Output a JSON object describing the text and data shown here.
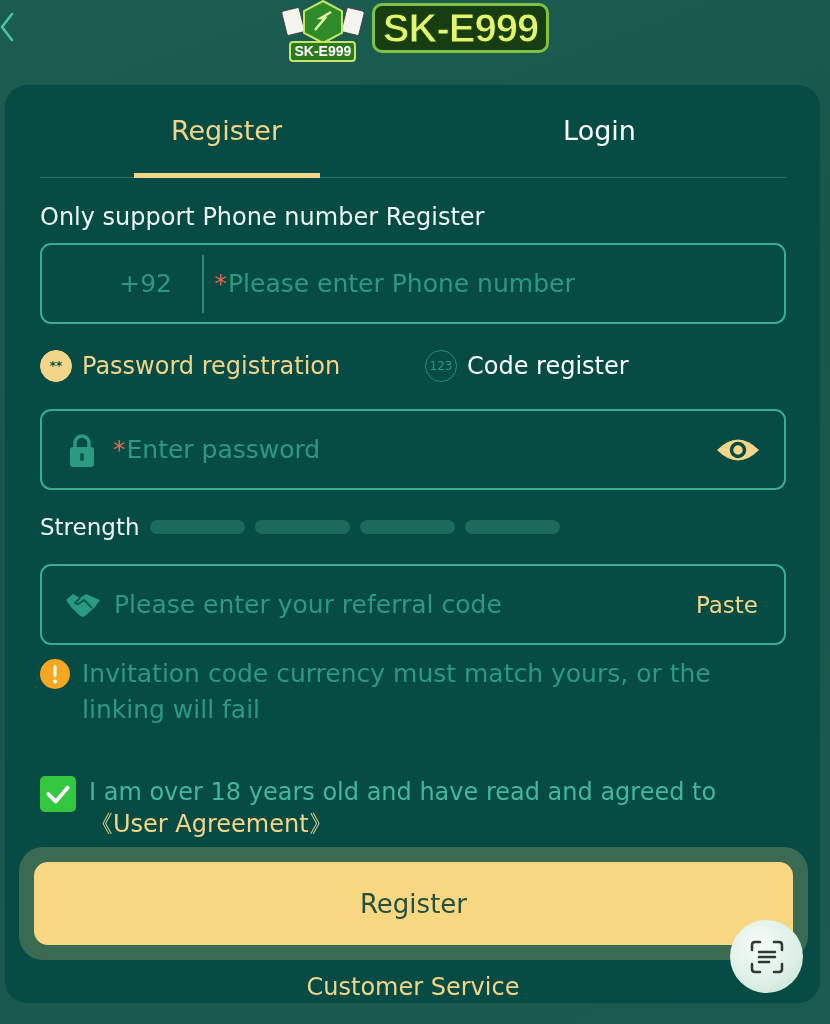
{
  "logo": {
    "emblem_text": "SK-E999",
    "wordmark": "SK-E999"
  },
  "tabs": [
    {
      "label": "Register",
      "selected": true
    },
    {
      "label": "Login",
      "selected": false
    }
  ],
  "phone_section": {
    "label": "Only support Phone number Register",
    "country_code": "+92",
    "required_mark": "*",
    "placeholder": "Please enter Phone number"
  },
  "register_modes": [
    {
      "icon_text": "**",
      "label": "Password registration",
      "selected": true
    },
    {
      "icon_text": "123",
      "label": "Code register",
      "selected": false
    }
  ],
  "password_field": {
    "required_mark": "*",
    "placeholder": "Enter password"
  },
  "strength": {
    "label": "Strength",
    "segments": [
      {
        "lit": false
      },
      {
        "lit": false
      },
      {
        "lit": false
      },
      {
        "lit": false
      }
    ]
  },
  "referral_field": {
    "placeholder": "Please enter your referral code",
    "paste_label": "Paste"
  },
  "notice": {
    "text": "Invitation code currency must match yours, or the linking will fail"
  },
  "agreement": {
    "checked": true,
    "text": "I am over 18 years old and have read and agreed to",
    "link": "《User Agreement》"
  },
  "submit_button": {
    "label": "Register"
  },
  "customer_service": "Customer Service"
}
